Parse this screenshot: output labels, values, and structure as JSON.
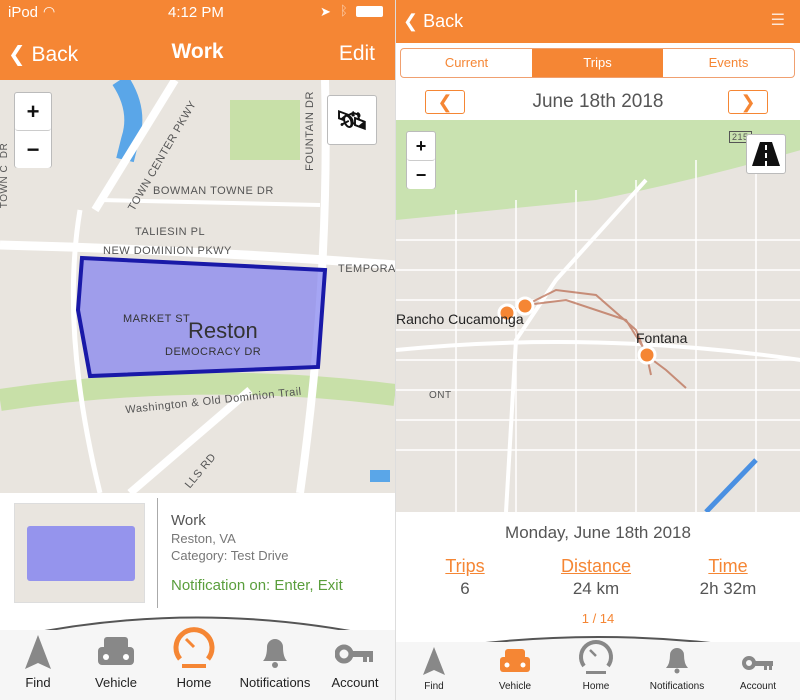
{
  "left": {
    "status": {
      "carrier": "iPod",
      "time": "4:12 PM"
    },
    "nav": {
      "back": "Back",
      "title": "Work",
      "edit": "Edit"
    },
    "map": {
      "zoom_in": "+",
      "zoom_out": "−",
      "labels": {
        "town_center": "TOWN CENTER PKWY",
        "bowman": "BOWMAN TOWNE DR",
        "taliesin": "TALIESIN PL",
        "new_dominion": "NEW DOMINION PKWY",
        "market": "MARKET ST",
        "reston": "Reston",
        "democracy": "DEMOCRACY DR",
        "trail": "Washington & Old Dominion Trail",
        "fountain": "FOUNTAIN DR",
        "tempora": "TEMPORA",
        "town_dr": "TOWN C  DR",
        "lls": "LLS RD"
      }
    },
    "info": {
      "name": "Work",
      "location": "Reston, VA",
      "category": "Category: Test Drive",
      "notification": "Notification on: Enter, Exit"
    },
    "tabs": [
      {
        "label": "Find"
      },
      {
        "label": "Vehicle"
      },
      {
        "label": "Home",
        "active": true
      },
      {
        "label": "Notifications"
      },
      {
        "label": "Account"
      }
    ]
  },
  "right": {
    "nav": {
      "back": "Back"
    },
    "segments": [
      {
        "label": "Current"
      },
      {
        "label": "Trips",
        "active": true
      },
      {
        "label": "Events"
      }
    ],
    "date": "June 18th 2018",
    "map": {
      "zoom_in": "+",
      "zoom_out": "−",
      "labels": {
        "rancho": "Rancho Cucamonga",
        "fontana": "Fontana",
        "ont": "ONT",
        "hwy": "215"
      }
    },
    "summary": {
      "date": "Monday, June 18th 2018",
      "trips_label": "Trips",
      "trips": "6",
      "distance_label": "Distance",
      "distance": "24 km",
      "time_label": "Time",
      "time": "2h 32m",
      "page": "1 / 14"
    },
    "tabs": [
      {
        "label": "Find"
      },
      {
        "label": "Vehicle",
        "active": true
      },
      {
        "label": "Home"
      },
      {
        "label": "Notifications"
      },
      {
        "label": "Account"
      }
    ]
  },
  "colors": {
    "accent": "#f58634",
    "geofence": "#6b6bf0",
    "notification": "#5a9e3c"
  }
}
